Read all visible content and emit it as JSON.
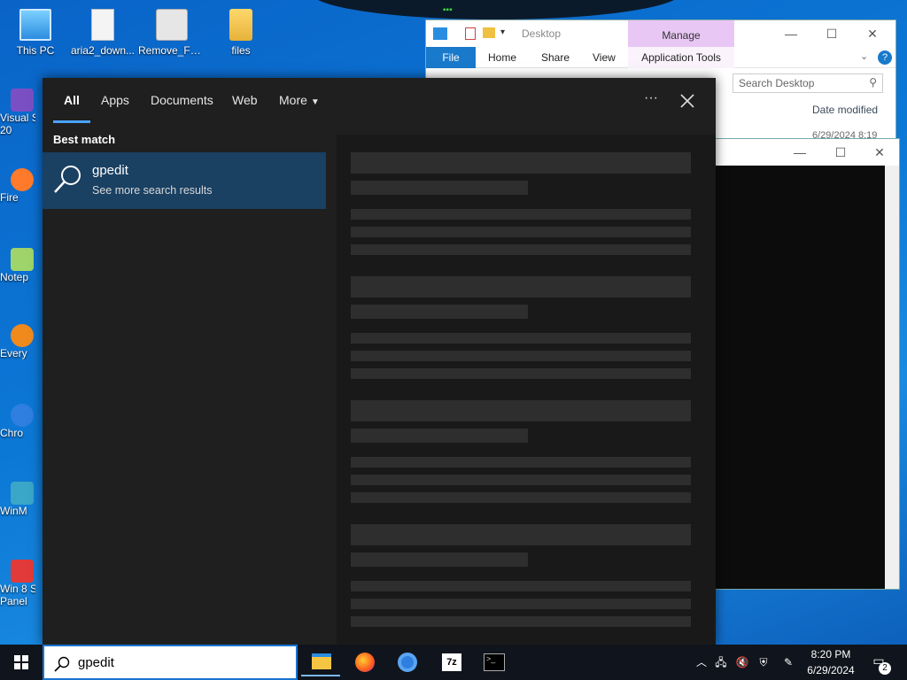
{
  "desktop": {
    "icons": [
      {
        "label": "This PC"
      },
      {
        "label": "aria2_down..."
      },
      {
        "label": "Remove_Fai..."
      },
      {
        "label": "files"
      }
    ],
    "left_column": [
      "Visual St\n20",
      "Fire",
      "Notep",
      "Every",
      "Chro",
      "WinM",
      "Win 8 S\nPanel"
    ]
  },
  "explorer": {
    "title": "Desktop",
    "manage_tab": "Manage",
    "file_tab": "File",
    "tabs": [
      "Home",
      "Share",
      "View"
    ],
    "app_tools_tab": "Application Tools",
    "search_placeholder": "Search Desktop",
    "column_header": "Date modified",
    "row_date": "6/29/2024 8:19"
  },
  "search_panel": {
    "tabs": [
      {
        "label": "All",
        "active": true
      },
      {
        "label": "Apps"
      },
      {
        "label": "Documents"
      },
      {
        "label": "Web"
      },
      {
        "label": "More"
      }
    ],
    "best_match_header": "Best match",
    "best_match": {
      "title": "gpedit",
      "subtitle": "See more search results"
    }
  },
  "taskbar": {
    "search_query": "gpedit",
    "clock_time": "8:20 PM",
    "clock_date": "6/29/2024",
    "notification_count": "2",
    "apps": [
      "file-explorer-icon",
      "firefox-icon",
      "chrome-icon",
      "7zip-icon",
      "terminal-icon"
    ]
  },
  "colors": {
    "desktop_blue": "#0c78d6",
    "panel_bg": "#1f1f1f",
    "selected_result": "#1a4062",
    "accent": "#4aa3ff",
    "taskbar": "#10141c"
  }
}
